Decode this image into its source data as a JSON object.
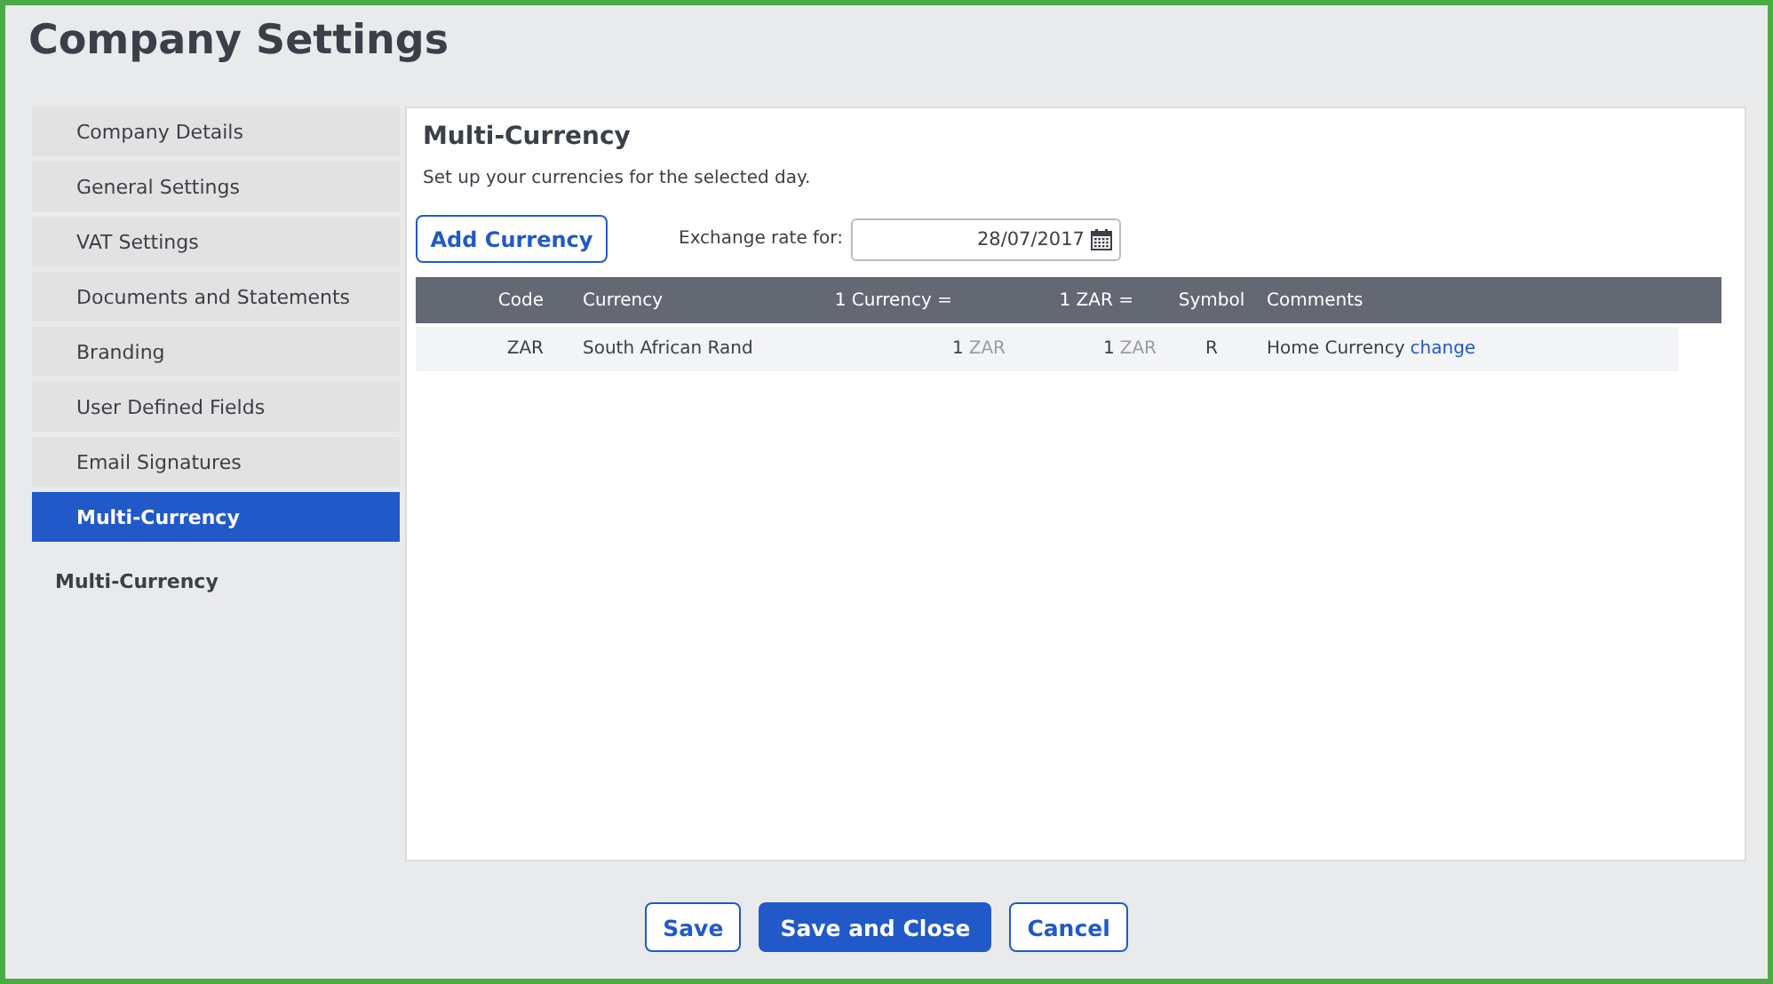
{
  "page": {
    "title": "Company Settings"
  },
  "sidebar": {
    "items": [
      {
        "label": "Company Details",
        "selected": false
      },
      {
        "label": "General Settings",
        "selected": false
      },
      {
        "label": "VAT Settings",
        "selected": false
      },
      {
        "label": "Documents and Statements",
        "selected": false
      },
      {
        "label": "Branding",
        "selected": false
      },
      {
        "label": "User Defined Fields",
        "selected": false
      },
      {
        "label": "Email Signatures",
        "selected": false
      },
      {
        "label": "Multi-Currency",
        "selected": true
      }
    ],
    "section_label": "Multi-Currency"
  },
  "panel": {
    "title": "Multi-Currency",
    "description": "Set up your currencies for the selected day.",
    "add_button": "Add Currency",
    "date_label": "Exchange rate for:",
    "date_value": "28/07/2017"
  },
  "table": {
    "columns": [
      "Code",
      "Currency",
      "1 Currency =",
      "1 ZAR =",
      "Symbol",
      "Comments"
    ],
    "rows": [
      {
        "code": "ZAR",
        "currency": "South African Rand",
        "rate_1": {
          "amount": "1",
          "unit": "ZAR"
        },
        "rate_2": {
          "amount": "1",
          "unit": "ZAR"
        },
        "symbol": "R",
        "comment": "Home Currency",
        "link": "change"
      }
    ]
  },
  "buttons": [
    {
      "label": "Save",
      "kind": "outline"
    },
    {
      "label": "Save and Close",
      "kind": "primary"
    },
    {
      "label": "Cancel",
      "kind": "outline"
    }
  ]
}
